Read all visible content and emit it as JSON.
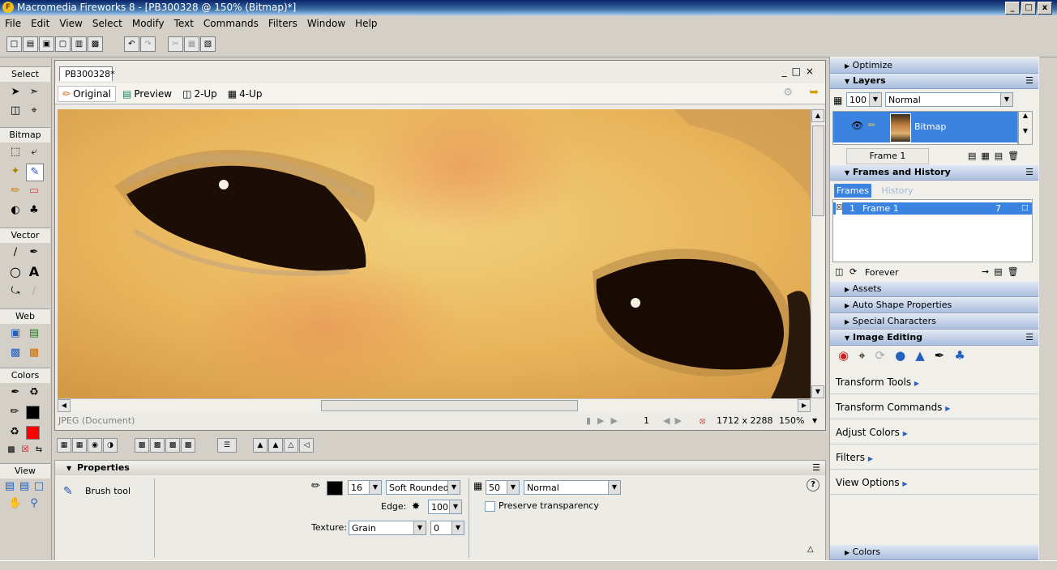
{
  "window": {
    "title": "Macromedia Fireworks 8 - [PB300328 @ 150% (Bitmap)*]"
  },
  "menu": [
    "File",
    "Edit",
    "View",
    "Select",
    "Modify",
    "Text",
    "Commands",
    "Filters",
    "Window",
    "Help"
  ],
  "tools": {
    "sections": {
      "select": "Select",
      "bitmap": "Bitmap",
      "vector": "Vector",
      "web": "Web",
      "colors": "Colors",
      "view": "View"
    },
    "stroke_color": "#000000",
    "fill_color": "#ff0000"
  },
  "document": {
    "tab": "PB300328*",
    "views": {
      "original": "Original",
      "preview": "Preview",
      "two_up": "2-Up",
      "four_up": "4-Up"
    },
    "status": {
      "type": "JPEG (Document)",
      "frame": "1",
      "size": "1712 x 2288",
      "zoom": "150%"
    }
  },
  "properties": {
    "header": "Properties",
    "tool_name": "Brush tool",
    "stroke_size": "16",
    "stroke_category": "Soft Rounded",
    "opacity": "50",
    "blend_mode": "Normal",
    "edge_label": "Edge:",
    "edge_value": "100",
    "texture_label": "Texture:",
    "texture_name": "Grain",
    "texture_amount": "0",
    "preserve_transparency": "Preserve transparency",
    "help": "?"
  },
  "right_panel": {
    "optimize": "Optimize",
    "layers": {
      "title": "Layers",
      "opacity": "100",
      "blend": "Normal",
      "layer_name": "Bitmap",
      "frame": "Frame 1"
    },
    "frames_history": {
      "title": "Frames and History",
      "tab_frames": "Frames",
      "tab_history": "History",
      "row_number": "1",
      "row_name": "Frame 1",
      "row_delay": "7",
      "loop": "Forever"
    },
    "assets": "Assets",
    "auto_shape": "Auto Shape Properties",
    "special_chars": "Special Characters",
    "image_editing": {
      "title": "Image Editing",
      "buttons": [
        "Transform Tools",
        "Transform Commands",
        "Adjust Colors",
        "Filters",
        "View Options"
      ]
    },
    "colors": "Colors"
  }
}
